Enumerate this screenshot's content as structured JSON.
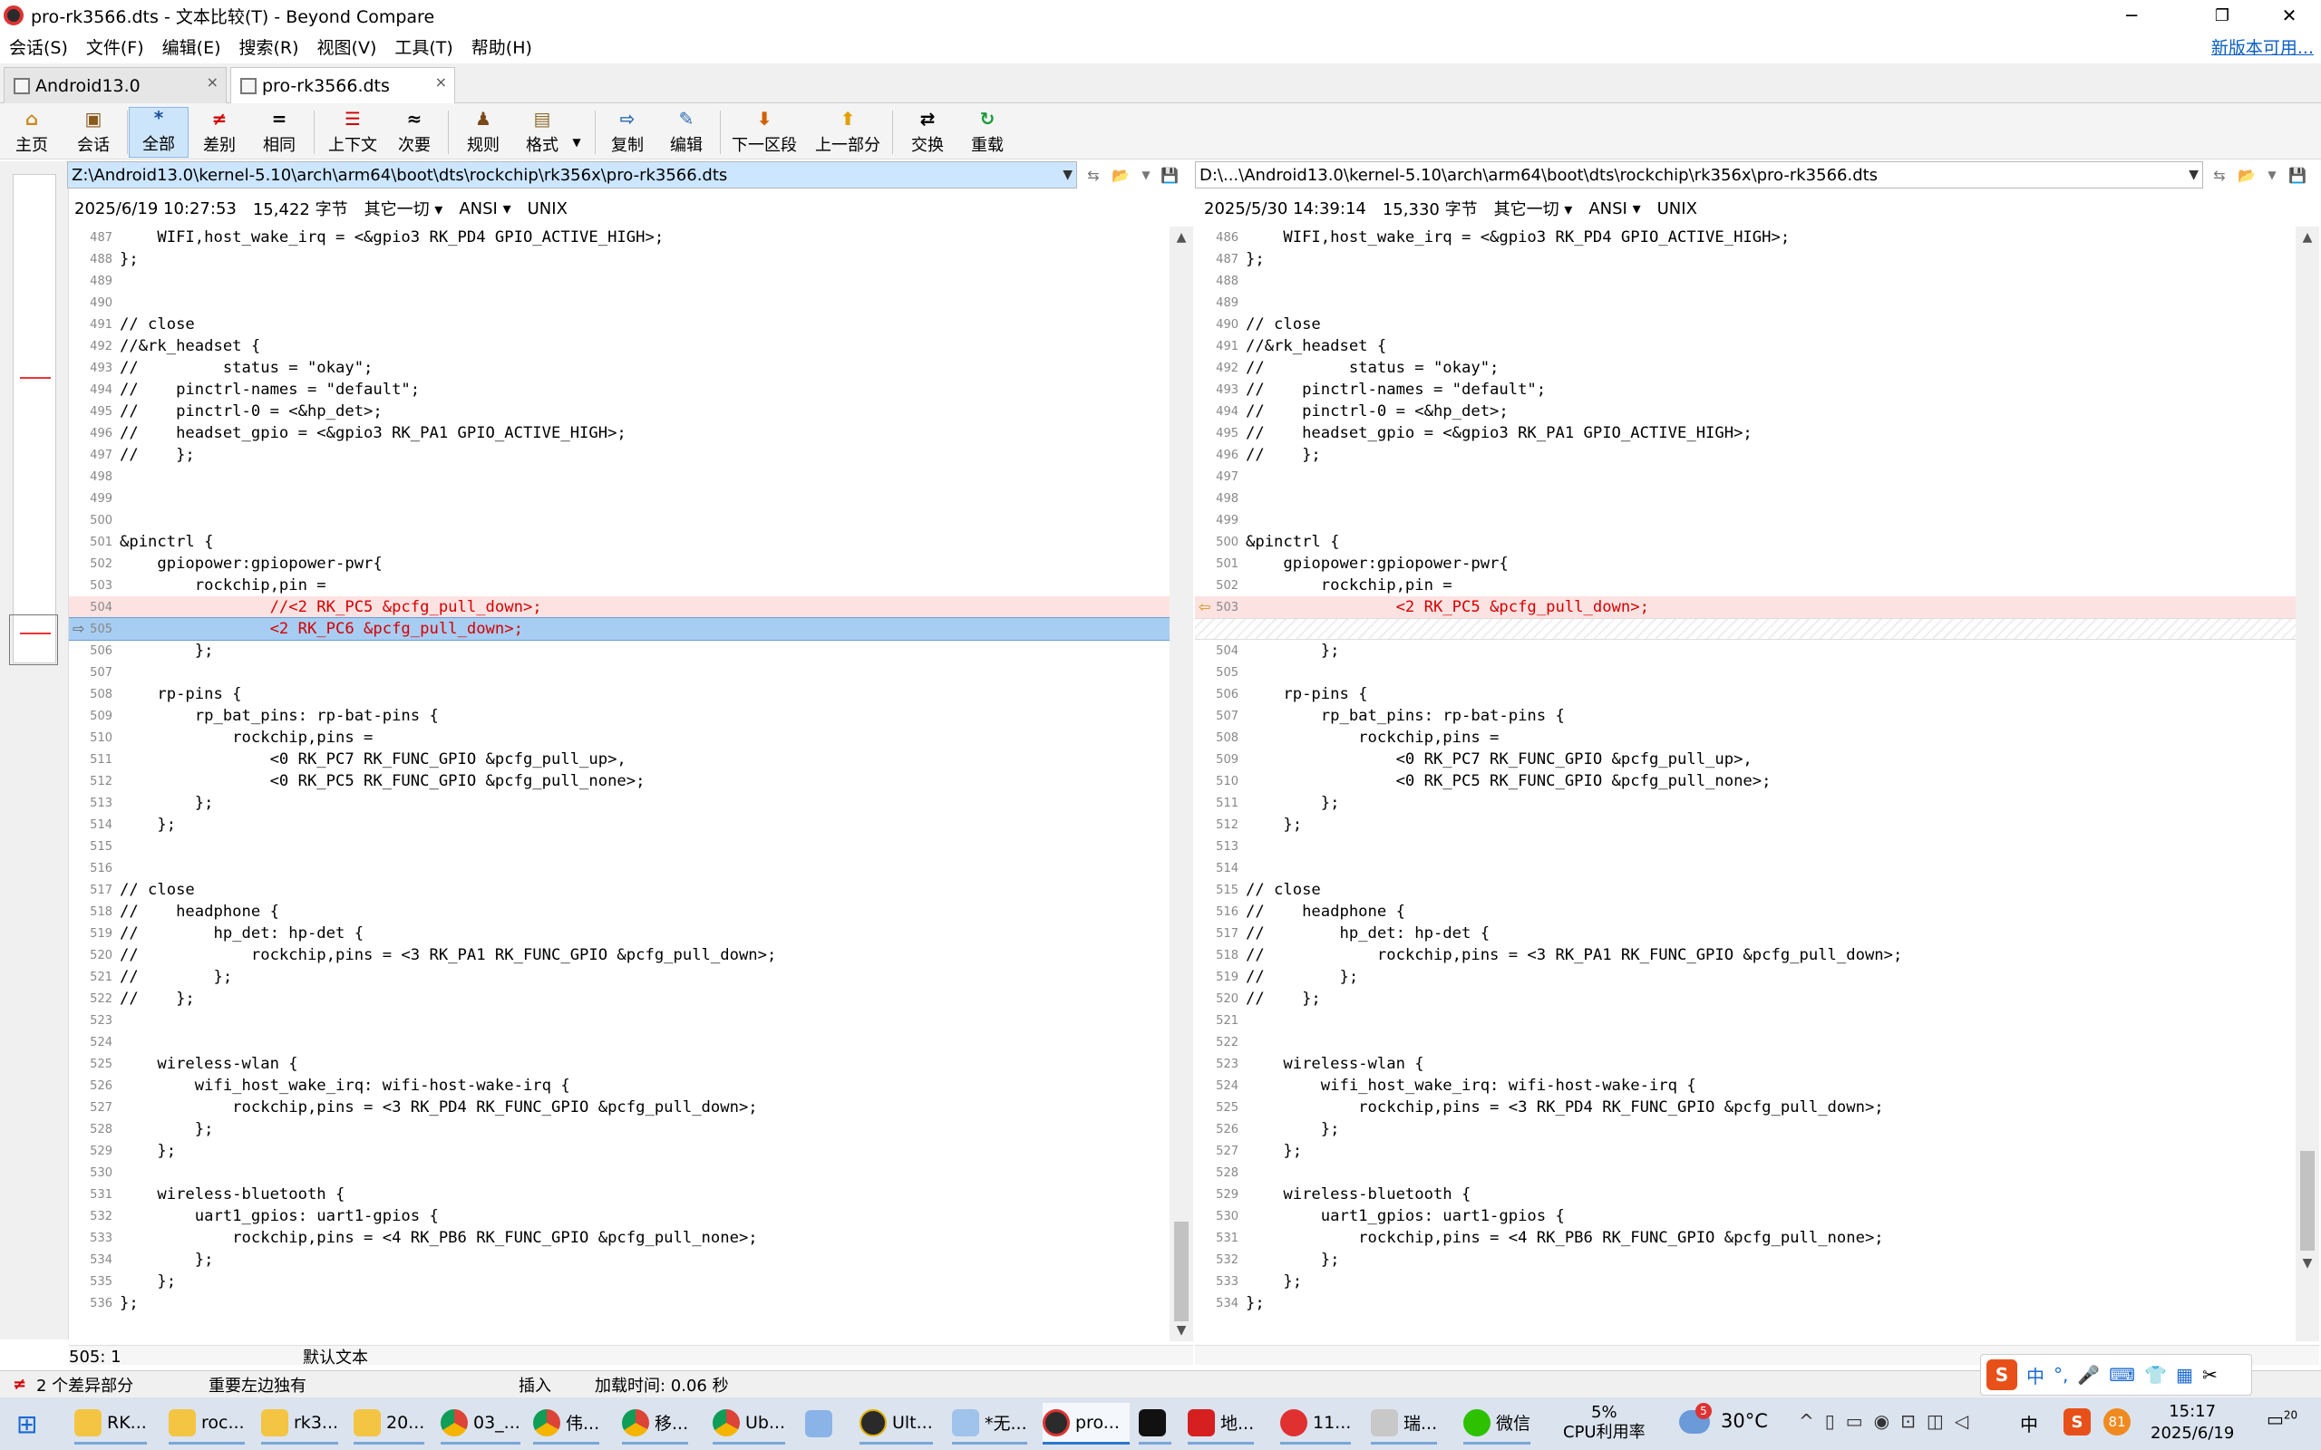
{
  "window": {
    "title": "pro-rk3566.dts - 文本比较(T) - Beyond Compare",
    "minimize": "─",
    "restore": "❐",
    "close": "✕"
  },
  "menu": {
    "items": [
      "会话(S)",
      "文件(F)",
      "编辑(E)",
      "搜索(R)",
      "视图(V)",
      "工具(T)",
      "帮助(H)"
    ],
    "update_link": "新版本可用..."
  },
  "tabs": [
    {
      "label": "Android13.0",
      "close": "×"
    },
    {
      "label": "pro-rk3566.dts",
      "close": "×"
    }
  ],
  "toolbar": {
    "home": "主页",
    "session": "会话",
    "all": "全部",
    "diffs": "差别",
    "same": "相同",
    "context": "上下文",
    "minor": "次要",
    "rules": "规则",
    "format": "格式",
    "copy": "复制",
    "edit": "编辑",
    "next_section": "下一区段",
    "prev_section": "上一部分",
    "swap": "交换",
    "reload": "重载"
  },
  "left": {
    "path": "Z:\\Android13.0\\kernel-5.10\\arch\\arm64\\boot\\dts\\rockchip\\rk356x\\pro-rk3566.dts",
    "datetime": "2025/6/19 10:27:53",
    "size": "15,422 字节",
    "other": "其它一切",
    "encoding": "ANSI",
    "eol": "UNIX",
    "cursor": "505: 1",
    "text_type": "默认文本",
    "lines": [
      {
        "n": "487",
        "t": "    WIFI,host_wake_irq = <&gpio3 RK_PD4 GPIO_ACTIVE_HIGH>;"
      },
      {
        "n": "488",
        "t": "};"
      },
      {
        "n": "489",
        "t": ""
      },
      {
        "n": "490",
        "t": ""
      },
      {
        "n": "491",
        "t": "// close"
      },
      {
        "n": "492",
        "t": "//&rk_headset {"
      },
      {
        "n": "493",
        "t": "//         status = \"okay\";"
      },
      {
        "n": "494",
        "t": "//    pinctrl-names = \"default\";"
      },
      {
        "n": "495",
        "t": "//    pinctrl-0 = <&hp_det>;"
      },
      {
        "n": "496",
        "t": "//    headset_gpio = <&gpio3 RK_PA1 GPIO_ACTIVE_HIGH>;"
      },
      {
        "n": "497",
        "t": "//    };"
      },
      {
        "n": "498",
        "t": ""
      },
      {
        "n": "499",
        "t": ""
      },
      {
        "n": "500",
        "t": ""
      },
      {
        "n": "501",
        "t": "&pinctrl {"
      },
      {
        "n": "502",
        "t": "    gpiopower:gpiopower-pwr{"
      },
      {
        "n": "503",
        "t": "        rockchip,pin ="
      },
      {
        "n": "504",
        "t": "                //<2 RK_PC5 &pcfg_pull_down>;",
        "k": "diff"
      },
      {
        "n": "505",
        "t": "                <2 RK_PC6 &pcfg_pull_down>;",
        "k": "cur"
      },
      {
        "n": "506",
        "t": "        };"
      },
      {
        "n": "507",
        "t": ""
      },
      {
        "n": "508",
        "t": "    rp-pins {"
      },
      {
        "n": "509",
        "t": "        rp_bat_pins: rp-bat-pins {"
      },
      {
        "n": "510",
        "t": "            rockchip,pins ="
      },
      {
        "n": "511",
        "t": "                <0 RK_PC7 RK_FUNC_GPIO &pcfg_pull_up>,"
      },
      {
        "n": "512",
        "t": "                <0 RK_PC5 RK_FUNC_GPIO &pcfg_pull_none>;"
      },
      {
        "n": "513",
        "t": "        };"
      },
      {
        "n": "514",
        "t": "    };"
      },
      {
        "n": "515",
        "t": ""
      },
      {
        "n": "516",
        "t": ""
      },
      {
        "n": "517",
        "t": "// close"
      },
      {
        "n": "518",
        "t": "//    headphone {"
      },
      {
        "n": "519",
        "t": "//        hp_det: hp-det {"
      },
      {
        "n": "520",
        "t": "//            rockchip,pins = <3 RK_PA1 RK_FUNC_GPIO &pcfg_pull_down>;"
      },
      {
        "n": "521",
        "t": "//        };"
      },
      {
        "n": "522",
        "t": "//    };"
      },
      {
        "n": "523",
        "t": ""
      },
      {
        "n": "524",
        "t": ""
      },
      {
        "n": "525",
        "t": "    wireless-wlan {"
      },
      {
        "n": "526",
        "t": "        wifi_host_wake_irq: wifi-host-wake-irq {"
      },
      {
        "n": "527",
        "t": "            rockchip,pins = <3 RK_PD4 RK_FUNC_GPIO &pcfg_pull_down>;"
      },
      {
        "n": "528",
        "t": "        };"
      },
      {
        "n": "529",
        "t": "    };"
      },
      {
        "n": "530",
        "t": ""
      },
      {
        "n": "531",
        "t": "    wireless-bluetooth {"
      },
      {
        "n": "532",
        "t": "        uart1_gpios: uart1-gpios {"
      },
      {
        "n": "533",
        "t": "            rockchip,pins = <4 RK_PB6 RK_FUNC_GPIO &pcfg_pull_none>;"
      },
      {
        "n": "534",
        "t": "        };"
      },
      {
        "n": "535",
        "t": "    };"
      },
      {
        "n": "536",
        "t": "};"
      }
    ]
  },
  "right": {
    "path": "D:\\...\\Android13.0\\kernel-5.10\\arch\\arm64\\boot\\dts\\rockchip\\rk356x\\pro-rk3566.dts",
    "datetime": "2025/5/30 14:39:14",
    "size": "15,330 字节",
    "other": "其它一切",
    "encoding": "ANSI",
    "eol": "UNIX",
    "lines": [
      {
        "n": "486",
        "t": "    WIFI,host_wake_irq = <&gpio3 RK_PD4 GPIO_ACTIVE_HIGH>;"
      },
      {
        "n": "487",
        "t": "};"
      },
      {
        "n": "488",
        "t": ""
      },
      {
        "n": "489",
        "t": ""
      },
      {
        "n": "490",
        "t": "// close"
      },
      {
        "n": "491",
        "t": "//&rk_headset {"
      },
      {
        "n": "492",
        "t": "//         status = \"okay\";"
      },
      {
        "n": "493",
        "t": "//    pinctrl-names = \"default\";"
      },
      {
        "n": "494",
        "t": "//    pinctrl-0 = <&hp_det>;"
      },
      {
        "n": "495",
        "t": "//    headset_gpio = <&gpio3 RK_PA1 GPIO_ACTIVE_HIGH>;"
      },
      {
        "n": "496",
        "t": "//    };"
      },
      {
        "n": "497",
        "t": ""
      },
      {
        "n": "498",
        "t": ""
      },
      {
        "n": "499",
        "t": ""
      },
      {
        "n": "500",
        "t": "&pinctrl {"
      },
      {
        "n": "501",
        "t": "    gpiopower:gpiopower-pwr{"
      },
      {
        "n": "502",
        "t": "        rockchip,pin ="
      },
      {
        "n": "503",
        "t": "                <2 RK_PC5 &pcfg_pull_down>;",
        "k": "diff"
      },
      {
        "n": "",
        "t": "",
        "k": "blank"
      },
      {
        "n": "504",
        "t": "        };"
      },
      {
        "n": "505",
        "t": ""
      },
      {
        "n": "506",
        "t": "    rp-pins {"
      },
      {
        "n": "507",
        "t": "        rp_bat_pins: rp-bat-pins {"
      },
      {
        "n": "508",
        "t": "            rockchip,pins ="
      },
      {
        "n": "509",
        "t": "                <0 RK_PC7 RK_FUNC_GPIO &pcfg_pull_up>,"
      },
      {
        "n": "510",
        "t": "                <0 RK_PC5 RK_FUNC_GPIO &pcfg_pull_none>;"
      },
      {
        "n": "511",
        "t": "        };"
      },
      {
        "n": "512",
        "t": "    };"
      },
      {
        "n": "513",
        "t": ""
      },
      {
        "n": "514",
        "t": ""
      },
      {
        "n": "515",
        "t": "// close"
      },
      {
        "n": "516",
        "t": "//    headphone {"
      },
      {
        "n": "517",
        "t": "//        hp_det: hp-det {"
      },
      {
        "n": "518",
        "t": "//            rockchip,pins = <3 RK_PA1 RK_FUNC_GPIO &pcfg_pull_down>;"
      },
      {
        "n": "519",
        "t": "//        };"
      },
      {
        "n": "520",
        "t": "//    };"
      },
      {
        "n": "521",
        "t": ""
      },
      {
        "n": "522",
        "t": ""
      },
      {
        "n": "523",
        "t": "    wireless-wlan {"
      },
      {
        "n": "524",
        "t": "        wifi_host_wake_irq: wifi-host-wake-irq {"
      },
      {
        "n": "525",
        "t": "            rockchip,pins = <3 RK_PD4 RK_FUNC_GPIO &pcfg_pull_down>;"
      },
      {
        "n": "526",
        "t": "        };"
      },
      {
        "n": "527",
        "t": "    };"
      },
      {
        "n": "528",
        "t": ""
      },
      {
        "n": "529",
        "t": "    wireless-bluetooth {"
      },
      {
        "n": "530",
        "t": "        uart1_gpios: uart1-gpios {"
      },
      {
        "n": "531",
        "t": "            rockchip,pins = <4 RK_PB6 RK_FUNC_GPIO &pcfg_pull_none>;"
      },
      {
        "n": "532",
        "t": "        };"
      },
      {
        "n": "533",
        "t": "    };"
      },
      {
        "n": "534",
        "t": "};"
      }
    ]
  },
  "status": {
    "diff_count": "2 个差异部分",
    "importance": "重要左边独有",
    "mode": "插入",
    "load_time": "加载时间: 0.06 秒"
  },
  "taskbar": {
    "items": [
      "RK...",
      "roc...",
      "rk3...",
      "20...",
      "03_...",
      "伟...",
      "移...",
      "Ub...",
      "",
      "Ult...",
      "*无...",
      "pro...",
      "",
      "地...",
      "11...",
      "瑞...",
      "微信"
    ],
    "cpu_value": "5%",
    "cpu_label": "CPU利用率",
    "weather_badge": "5",
    "temperature": "30°C",
    "ime_lang": "中",
    "tray_badge": "81",
    "time": "15:17",
    "date": "2025/6/19",
    "notifications": "20"
  },
  "colors": {
    "diff_bg": "#fde2e2",
    "diff_text": "#d40000",
    "current_line": "#a8cdf2",
    "accent": "#2b77d0"
  }
}
